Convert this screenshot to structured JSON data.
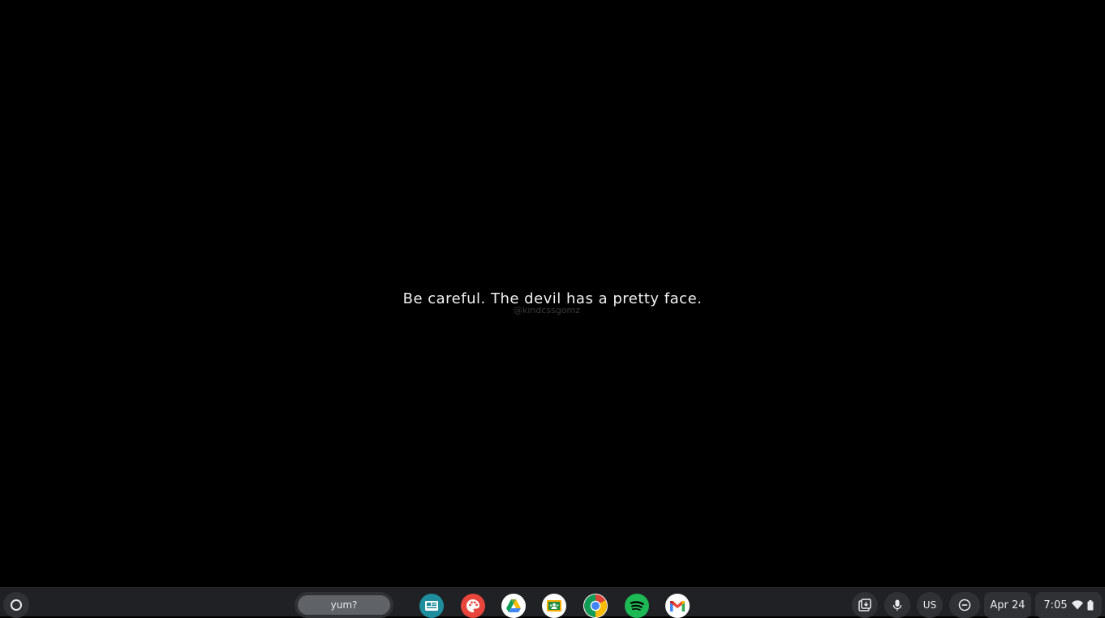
{
  "wallpaper": {
    "quote": "Be careful. The devil has a pretty face.",
    "watermark": "@kindcssgomz"
  },
  "shelf": {
    "launcher_icon": "launcher-circle-icon",
    "desk_label": "yum?",
    "apps": [
      {
        "name": "news-app",
        "icon": "news-icon"
      },
      {
        "name": "paint-app",
        "icon": "palette-icon"
      },
      {
        "name": "drive-app",
        "icon": "google-drive-icon"
      },
      {
        "name": "classroom-app",
        "icon": "google-classroom-icon"
      },
      {
        "name": "chrome-app",
        "icon": "chrome-icon"
      },
      {
        "name": "spotify-app",
        "icon": "spotify-icon"
      },
      {
        "name": "gmail-app",
        "icon": "gmail-icon"
      }
    ],
    "tray": {
      "input_method": "US",
      "date": "Apr 24",
      "time": "7:05"
    }
  },
  "colors": {
    "background": "#000000",
    "shelf": "#202124",
    "tray_button": "#303134",
    "text": "#e8eaed",
    "spotify_green": "#1db954",
    "gmail_red": "#ea4335"
  }
}
